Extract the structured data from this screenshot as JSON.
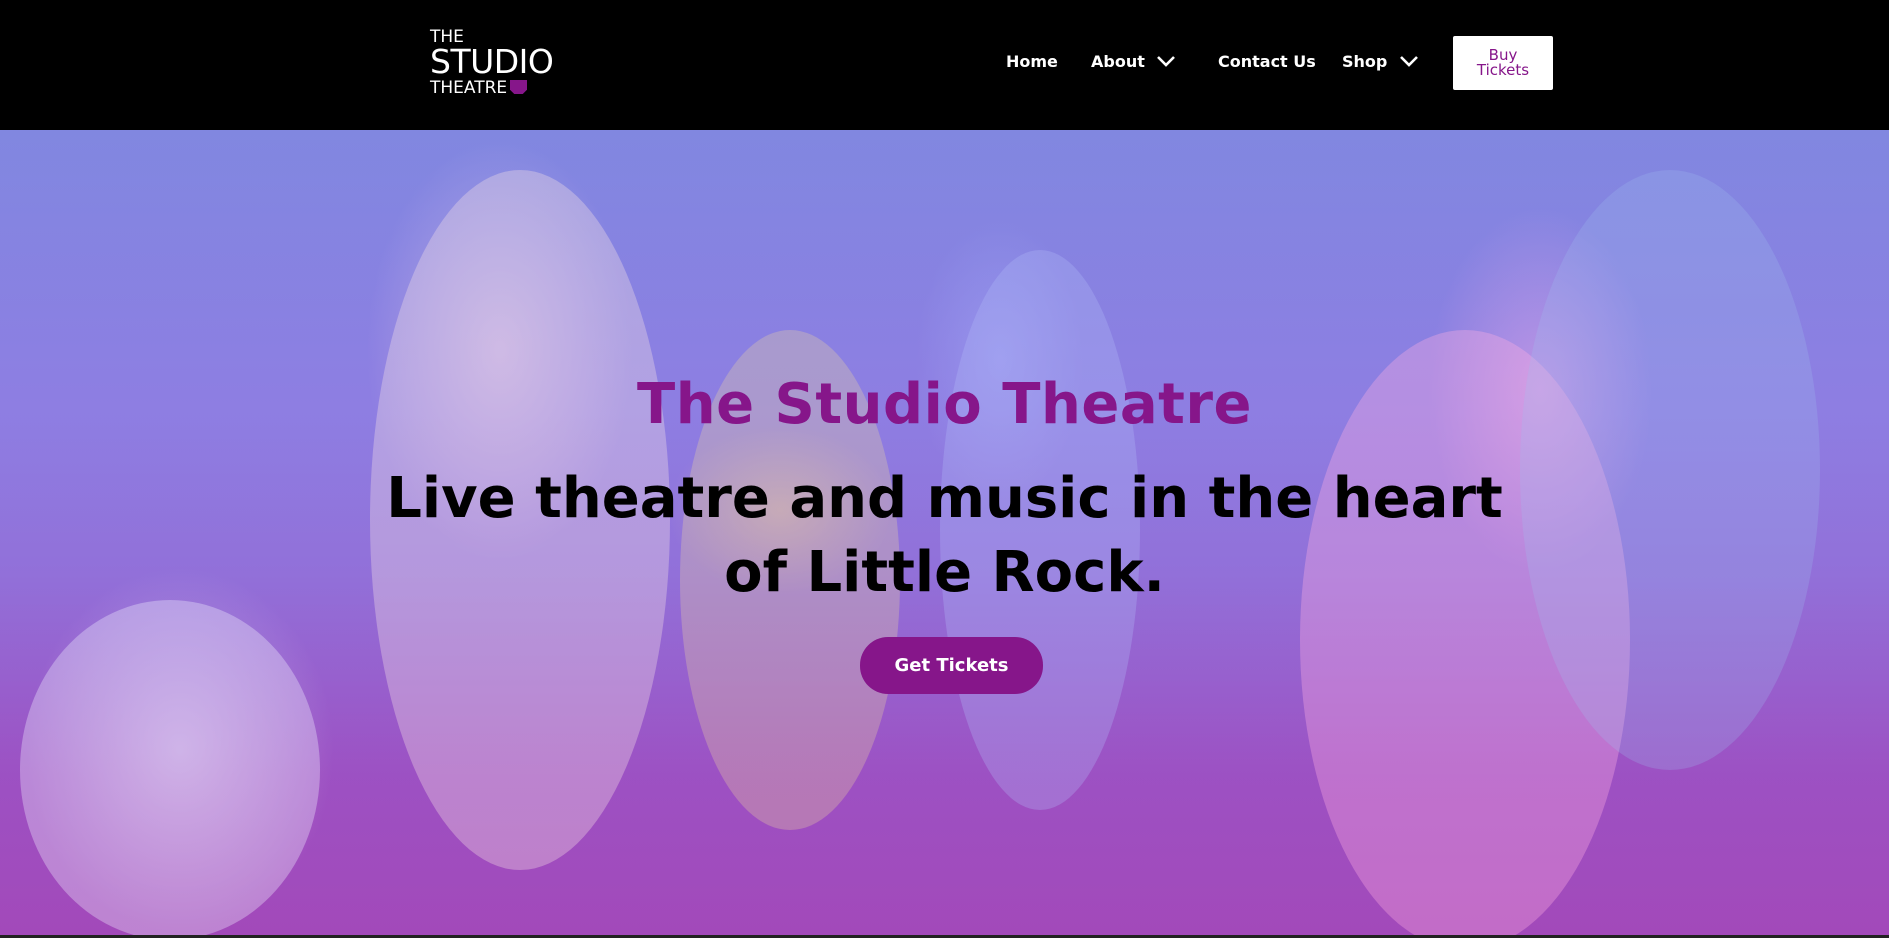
{
  "logo": {
    "line1": "THE",
    "line2": "STUDIO",
    "line3": "THEATRE"
  },
  "nav": {
    "items": [
      {
        "label": "Home"
      },
      {
        "label": "About",
        "has_dropdown": true
      },
      {
        "label": "Contact Us"
      },
      {
        "label": "Shop",
        "has_dropdown": true
      }
    ],
    "buy_tickets": "Buy Tickets"
  },
  "hero": {
    "title": "The Studio Theatre",
    "subtitle": "Live theatre and music in the heart of Little Rock.",
    "cta": "Get Tickets"
  },
  "colors": {
    "brand": "#86168a",
    "header_bg": "#000000",
    "text": "#000000"
  }
}
